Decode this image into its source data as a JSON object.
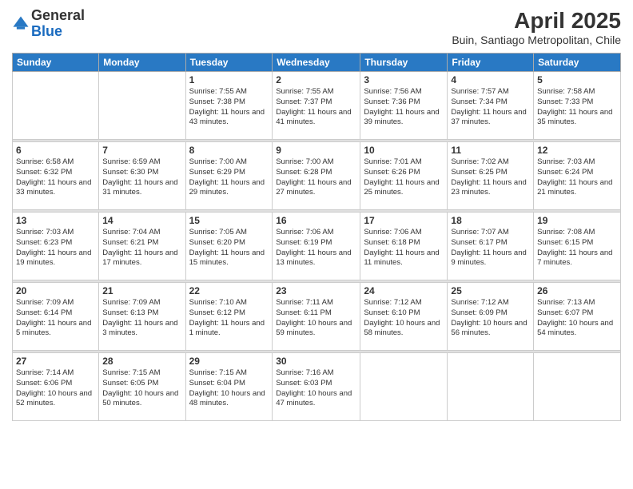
{
  "logo": {
    "general": "General",
    "blue": "Blue"
  },
  "title": {
    "month": "April 2025",
    "location": "Buin, Santiago Metropolitan, Chile"
  },
  "weekdays": [
    "Sunday",
    "Monday",
    "Tuesday",
    "Wednesday",
    "Thursday",
    "Friday",
    "Saturday"
  ],
  "weeks": [
    [
      {
        "day": "",
        "sunrise": "",
        "sunset": "",
        "daylight": ""
      },
      {
        "day": "",
        "sunrise": "",
        "sunset": "",
        "daylight": ""
      },
      {
        "day": "1",
        "sunrise": "Sunrise: 7:55 AM",
        "sunset": "Sunset: 7:38 PM",
        "daylight": "Daylight: 11 hours and 43 minutes."
      },
      {
        "day": "2",
        "sunrise": "Sunrise: 7:55 AM",
        "sunset": "Sunset: 7:37 PM",
        "daylight": "Daylight: 11 hours and 41 minutes."
      },
      {
        "day": "3",
        "sunrise": "Sunrise: 7:56 AM",
        "sunset": "Sunset: 7:36 PM",
        "daylight": "Daylight: 11 hours and 39 minutes."
      },
      {
        "day": "4",
        "sunrise": "Sunrise: 7:57 AM",
        "sunset": "Sunset: 7:34 PM",
        "daylight": "Daylight: 11 hours and 37 minutes."
      },
      {
        "day": "5",
        "sunrise": "Sunrise: 7:58 AM",
        "sunset": "Sunset: 7:33 PM",
        "daylight": "Daylight: 11 hours and 35 minutes."
      }
    ],
    [
      {
        "day": "6",
        "sunrise": "Sunrise: 6:58 AM",
        "sunset": "Sunset: 6:32 PM",
        "daylight": "Daylight: 11 hours and 33 minutes."
      },
      {
        "day": "7",
        "sunrise": "Sunrise: 6:59 AM",
        "sunset": "Sunset: 6:30 PM",
        "daylight": "Daylight: 11 hours and 31 minutes."
      },
      {
        "day": "8",
        "sunrise": "Sunrise: 7:00 AM",
        "sunset": "Sunset: 6:29 PM",
        "daylight": "Daylight: 11 hours and 29 minutes."
      },
      {
        "day": "9",
        "sunrise": "Sunrise: 7:00 AM",
        "sunset": "Sunset: 6:28 PM",
        "daylight": "Daylight: 11 hours and 27 minutes."
      },
      {
        "day": "10",
        "sunrise": "Sunrise: 7:01 AM",
        "sunset": "Sunset: 6:26 PM",
        "daylight": "Daylight: 11 hours and 25 minutes."
      },
      {
        "day": "11",
        "sunrise": "Sunrise: 7:02 AM",
        "sunset": "Sunset: 6:25 PM",
        "daylight": "Daylight: 11 hours and 23 minutes."
      },
      {
        "day": "12",
        "sunrise": "Sunrise: 7:03 AM",
        "sunset": "Sunset: 6:24 PM",
        "daylight": "Daylight: 11 hours and 21 minutes."
      }
    ],
    [
      {
        "day": "13",
        "sunrise": "Sunrise: 7:03 AM",
        "sunset": "Sunset: 6:23 PM",
        "daylight": "Daylight: 11 hours and 19 minutes."
      },
      {
        "day": "14",
        "sunrise": "Sunrise: 7:04 AM",
        "sunset": "Sunset: 6:21 PM",
        "daylight": "Daylight: 11 hours and 17 minutes."
      },
      {
        "day": "15",
        "sunrise": "Sunrise: 7:05 AM",
        "sunset": "Sunset: 6:20 PM",
        "daylight": "Daylight: 11 hours and 15 minutes."
      },
      {
        "day": "16",
        "sunrise": "Sunrise: 7:06 AM",
        "sunset": "Sunset: 6:19 PM",
        "daylight": "Daylight: 11 hours and 13 minutes."
      },
      {
        "day": "17",
        "sunrise": "Sunrise: 7:06 AM",
        "sunset": "Sunset: 6:18 PM",
        "daylight": "Daylight: 11 hours and 11 minutes."
      },
      {
        "day": "18",
        "sunrise": "Sunrise: 7:07 AM",
        "sunset": "Sunset: 6:17 PM",
        "daylight": "Daylight: 11 hours and 9 minutes."
      },
      {
        "day": "19",
        "sunrise": "Sunrise: 7:08 AM",
        "sunset": "Sunset: 6:15 PM",
        "daylight": "Daylight: 11 hours and 7 minutes."
      }
    ],
    [
      {
        "day": "20",
        "sunrise": "Sunrise: 7:09 AM",
        "sunset": "Sunset: 6:14 PM",
        "daylight": "Daylight: 11 hours and 5 minutes."
      },
      {
        "day": "21",
        "sunrise": "Sunrise: 7:09 AM",
        "sunset": "Sunset: 6:13 PM",
        "daylight": "Daylight: 11 hours and 3 minutes."
      },
      {
        "day": "22",
        "sunrise": "Sunrise: 7:10 AM",
        "sunset": "Sunset: 6:12 PM",
        "daylight": "Daylight: 11 hours and 1 minute."
      },
      {
        "day": "23",
        "sunrise": "Sunrise: 7:11 AM",
        "sunset": "Sunset: 6:11 PM",
        "daylight": "Daylight: 10 hours and 59 minutes."
      },
      {
        "day": "24",
        "sunrise": "Sunrise: 7:12 AM",
        "sunset": "Sunset: 6:10 PM",
        "daylight": "Daylight: 10 hours and 58 minutes."
      },
      {
        "day": "25",
        "sunrise": "Sunrise: 7:12 AM",
        "sunset": "Sunset: 6:09 PM",
        "daylight": "Daylight: 10 hours and 56 minutes."
      },
      {
        "day": "26",
        "sunrise": "Sunrise: 7:13 AM",
        "sunset": "Sunset: 6:07 PM",
        "daylight": "Daylight: 10 hours and 54 minutes."
      }
    ],
    [
      {
        "day": "27",
        "sunrise": "Sunrise: 7:14 AM",
        "sunset": "Sunset: 6:06 PM",
        "daylight": "Daylight: 10 hours and 52 minutes."
      },
      {
        "day": "28",
        "sunrise": "Sunrise: 7:15 AM",
        "sunset": "Sunset: 6:05 PM",
        "daylight": "Daylight: 10 hours and 50 minutes."
      },
      {
        "day": "29",
        "sunrise": "Sunrise: 7:15 AM",
        "sunset": "Sunset: 6:04 PM",
        "daylight": "Daylight: 10 hours and 48 minutes."
      },
      {
        "day": "30",
        "sunrise": "Sunrise: 7:16 AM",
        "sunset": "Sunset: 6:03 PM",
        "daylight": "Daylight: 10 hours and 47 minutes."
      },
      {
        "day": "",
        "sunrise": "",
        "sunset": "",
        "daylight": ""
      },
      {
        "day": "",
        "sunrise": "",
        "sunset": "",
        "daylight": ""
      },
      {
        "day": "",
        "sunrise": "",
        "sunset": "",
        "daylight": ""
      }
    ]
  ]
}
